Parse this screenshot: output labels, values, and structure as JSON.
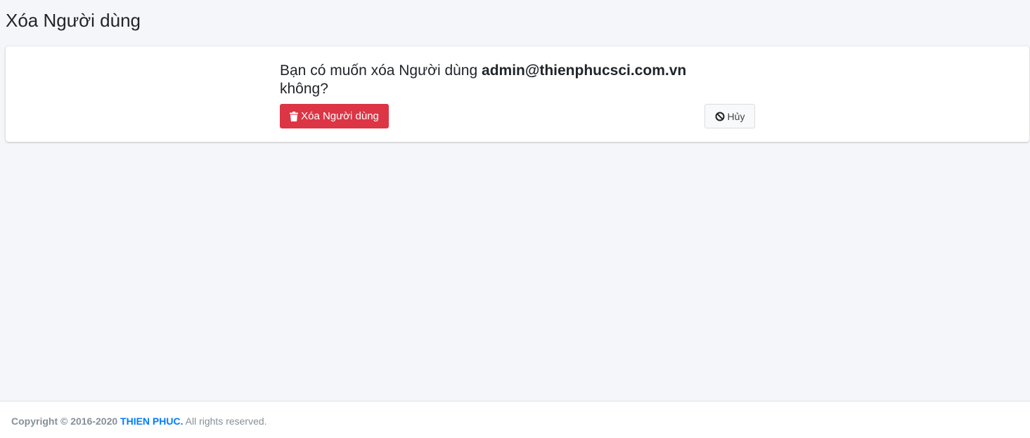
{
  "page": {
    "title": "Xóa Người dùng"
  },
  "confirm": {
    "question_prefix": "Bạn có muốn xóa Người dùng",
    "email": "admin@thienphucsci.com.vn",
    "question_suffix": "không?",
    "delete_label": "Xóa Người dùng",
    "cancel_label": "Hủy"
  },
  "footer": {
    "copyright_prefix": "Copyright © 2016-2020",
    "brand": "THIEN PHUC.",
    "suffix": "All rights reserved."
  },
  "colors": {
    "danger": "#dc3545",
    "link": "#007bff",
    "background": "#f4f6f9"
  },
  "icons": {
    "delete": "trash-icon",
    "cancel": "ban-icon"
  }
}
